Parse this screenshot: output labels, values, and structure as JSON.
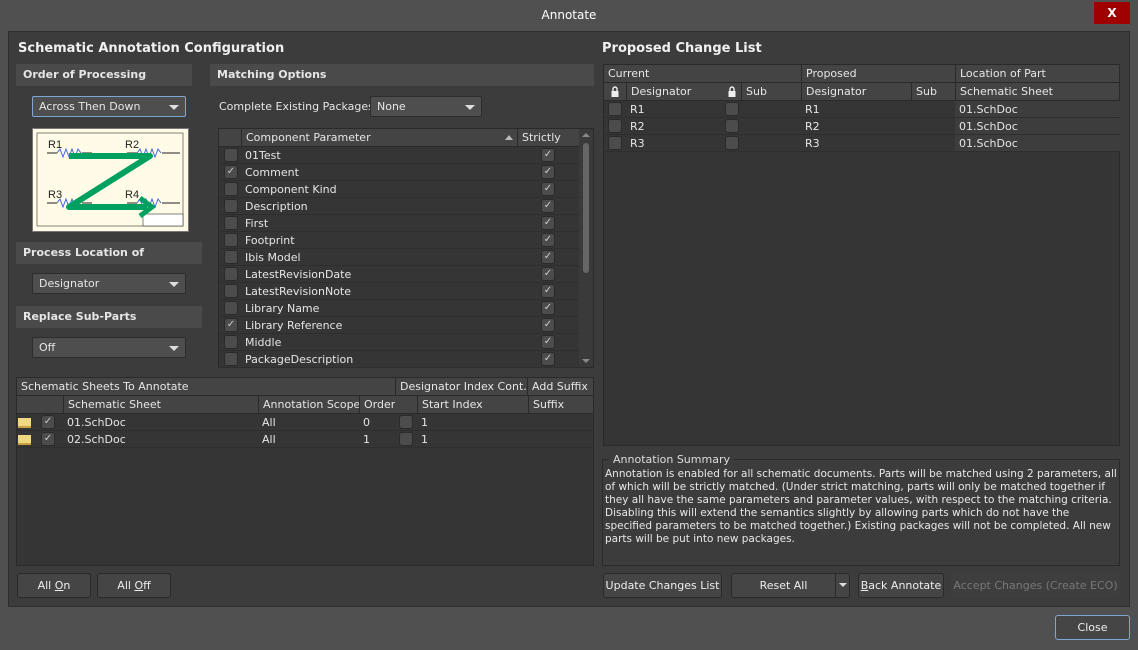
{
  "window": {
    "title": "Annotate",
    "close_glyph": "X"
  },
  "config": {
    "title": "Schematic Annotation Configuration",
    "order": {
      "label": "Order of Processing",
      "value": "Across Then Down",
      "preview_labels": [
        "R1",
        "R2",
        "R3",
        "R4"
      ]
    },
    "location": {
      "label": "Process Location of",
      "value": "Designator"
    },
    "subparts": {
      "label": "Replace Sub-Parts",
      "value": "Off"
    },
    "matching": {
      "label": "Matching Options",
      "packages_label": "Complete Existing Packages",
      "packages_value": "None",
      "columns": [
        "Component Parameter",
        "Strictly"
      ],
      "params": [
        {
          "name": "01Test",
          "checked": false,
          "strictly": true
        },
        {
          "name": "Comment",
          "checked": true,
          "strictly": true
        },
        {
          "name": "Component Kind",
          "checked": false,
          "strictly": true
        },
        {
          "name": "Description",
          "checked": false,
          "strictly": true
        },
        {
          "name": "First",
          "checked": false,
          "strictly": true
        },
        {
          "name": "Footprint",
          "checked": false,
          "strictly": true
        },
        {
          "name": "Ibis Model",
          "checked": false,
          "strictly": true
        },
        {
          "name": "LatestRevisionDate",
          "checked": false,
          "strictly": true
        },
        {
          "name": "LatestRevisionNote",
          "checked": false,
          "strictly": true
        },
        {
          "name": "Library Name",
          "checked": false,
          "strictly": true
        },
        {
          "name": "Library Reference",
          "checked": true,
          "strictly": true
        },
        {
          "name": "Middle",
          "checked": false,
          "strictly": true
        },
        {
          "name": "PackageDescription",
          "checked": false,
          "strictly": true
        }
      ]
    },
    "sheets": {
      "group_headers": [
        "Schematic Sheets To Annotate",
        "Designator Index Cont...",
        "Add Suffix"
      ],
      "columns": [
        "Schematic Sheet",
        "Annotation Scope",
        "Order",
        "Start Index",
        "Suffix"
      ],
      "rows": [
        {
          "sheet": "01.SchDoc",
          "scope": "All",
          "order": "0",
          "index_checked": false,
          "start": "1",
          "suffix": "",
          "checked": true
        },
        {
          "sheet": "02.SchDoc",
          "scope": "All",
          "order": "1",
          "index_checked": false,
          "start": "1",
          "suffix": "",
          "checked": true
        }
      ]
    },
    "buttons": {
      "all_on_pre": "All ",
      "all_on_u": "O",
      "all_on_post": "n",
      "all_off_pre": "All ",
      "all_off_u": "O",
      "all_off_post": "ff"
    }
  },
  "changes": {
    "title": "Proposed Change List",
    "group_headers": [
      "Current",
      "Proposed",
      "Location of Part"
    ],
    "columns": [
      "Designator",
      "Sub",
      "Designator",
      "Sub",
      "Schematic Sheet"
    ],
    "rows": [
      {
        "current": "R1",
        "current_sub": "",
        "proposed": "R1",
        "proposed_sub": "",
        "sheet": "01.SchDoc"
      },
      {
        "current": "R2",
        "current_sub": "",
        "proposed": "R2",
        "proposed_sub": "",
        "sheet": "01.SchDoc"
      },
      {
        "current": "R3",
        "current_sub": "",
        "proposed": "R3",
        "proposed_sub": "",
        "sheet": "01.SchDoc"
      }
    ]
  },
  "summary": {
    "title": "Annotation Summary",
    "text": "Annotation is enabled for all schematic documents. Parts will be matched using 2 parameters, all of which will be strictly matched. (Under strict matching, parts will only be matched together if they all have the same parameters and parameter values, with respect to the matching criteria. Disabling this will extend the semantics slightly by allowing parts which do not have the specified parameters to be matched together.) Existing packages will not be completed. All new parts will be put into new packages."
  },
  "actions": {
    "update": "Update Changes List",
    "reset": "Reset All",
    "back_u": "B",
    "back_rest": "ack Annotate",
    "accept": "Accept Changes (Create ECO)",
    "close": "Close"
  },
  "colors": {
    "accent_arrow": "#00a060",
    "close_red": "#a00000",
    "focus_border": "#7ea6d4"
  }
}
